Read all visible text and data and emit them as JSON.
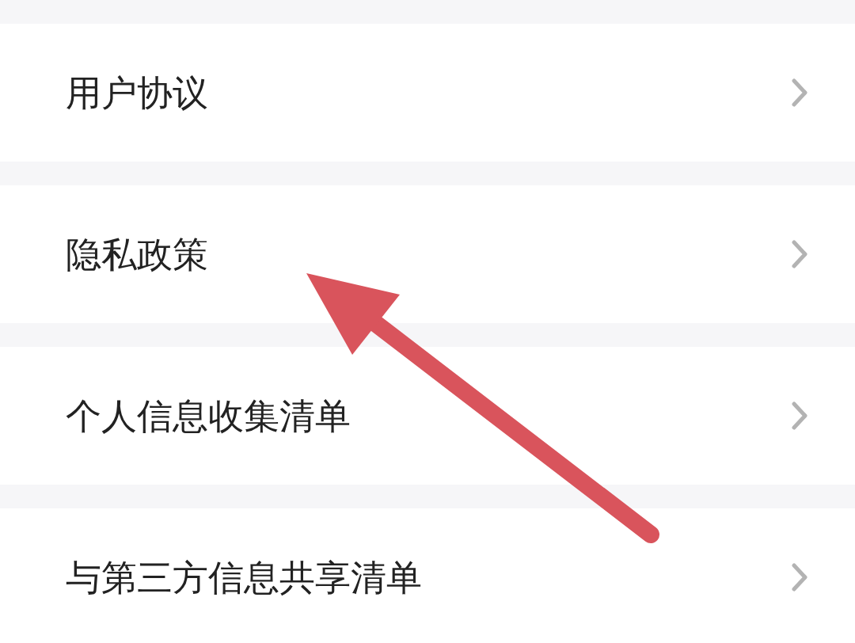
{
  "menu_items": [
    {
      "label": "用户协议"
    },
    {
      "label": "隐私政策"
    },
    {
      "label": "个人信息收集清单"
    },
    {
      "label": "与第三方信息共享清单"
    }
  ]
}
